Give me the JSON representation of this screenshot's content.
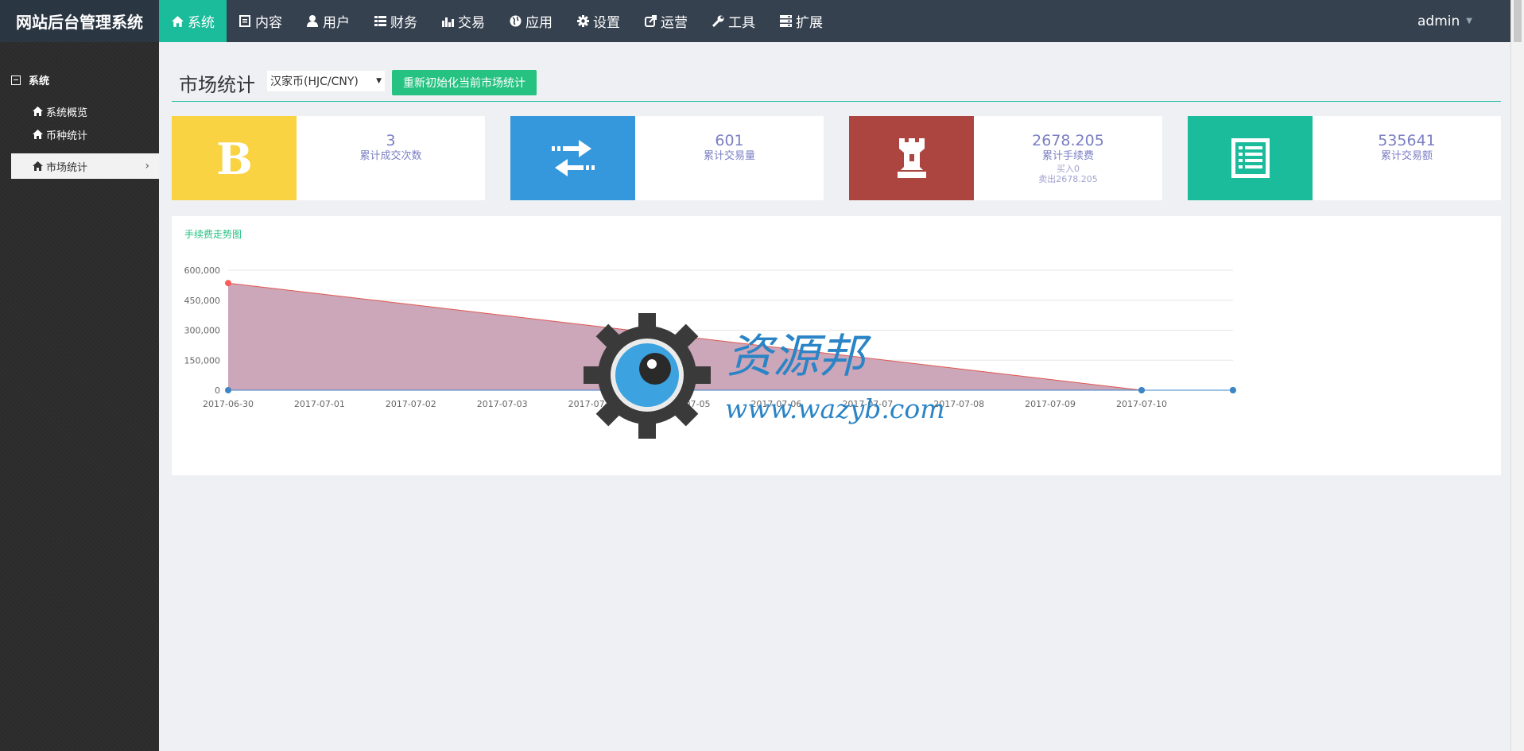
{
  "brand": "网站后台管理系统",
  "nav": [
    {
      "label": "系统",
      "icon": "home-icon",
      "active": true
    },
    {
      "label": "内容",
      "icon": "document-icon"
    },
    {
      "label": "用户",
      "icon": "user-icon"
    },
    {
      "label": "财务",
      "icon": "list-icon"
    },
    {
      "label": "交易",
      "icon": "bar-chart-icon"
    },
    {
      "label": "应用",
      "icon": "globe-icon"
    },
    {
      "label": "设置",
      "icon": "gear-icon"
    },
    {
      "label": "运营",
      "icon": "share-icon"
    },
    {
      "label": "工具",
      "icon": "wrench-icon"
    },
    {
      "label": "扩展",
      "icon": "server-icon"
    }
  ],
  "user": {
    "name": "admin"
  },
  "sidebar": {
    "section": "系统",
    "items": [
      {
        "label": "系统概览",
        "icon": "home-icon"
      },
      {
        "label": "币种统计",
        "icon": "home-icon"
      },
      {
        "label": "市场统计",
        "icon": "home-icon",
        "active": true
      }
    ]
  },
  "page": {
    "title": "市场统计",
    "market_select": "汉家币(HJC/CNY)",
    "reinit_button": "重新初始化当前市场统计"
  },
  "cards": [
    {
      "value": "3",
      "label": "累计成交次数",
      "icon": "bitcoin-icon",
      "color": "#f9d342"
    },
    {
      "value": "601",
      "label": "累计交易量",
      "icon": "exchange-arrows-icon",
      "color": "#3598dc"
    },
    {
      "value": "2678.205",
      "label": "累计手续费",
      "sub1": "买入0",
      "sub2": "卖出2678.205",
      "icon": "chess-rook-icon",
      "color": "#ac4540"
    },
    {
      "value": "535641",
      "label": "累计交易额",
      "icon": "list-alt-icon",
      "color": "#1bbc9b"
    }
  ],
  "chart_data": {
    "type": "area",
    "title": "手续费走势图",
    "x": [
      "2017-06-30",
      "2017-07-01",
      "2017-07-02",
      "2017-07-03",
      "2017-07-04",
      "2017-07-05",
      "2017-07-06",
      "2017-07-07",
      "2017-07-08",
      "2017-07-09",
      "2017-07-10"
    ],
    "series": [
      {
        "values": [
          535641,
          0,
          0
        ],
        "x_points": [
          "2017-06-30",
          "2017-07-10",
          "2017-07-11"
        ],
        "color": "#e0584f",
        "fill": "#c9a1b5"
      },
      {
        "values": [
          0,
          0,
          0
        ],
        "x_points": [
          "2017-06-30",
          "2017-07-10",
          "2017-07-11"
        ],
        "color": "#3d85c6"
      }
    ],
    "yticks": [
      "0",
      "150,000",
      "300,000",
      "450,000",
      "600,000"
    ],
    "ylim": [
      0,
      600000
    ],
    "grid": true
  },
  "watermark": {
    "title": "资源邦",
    "url": "www.wazyb.com"
  }
}
